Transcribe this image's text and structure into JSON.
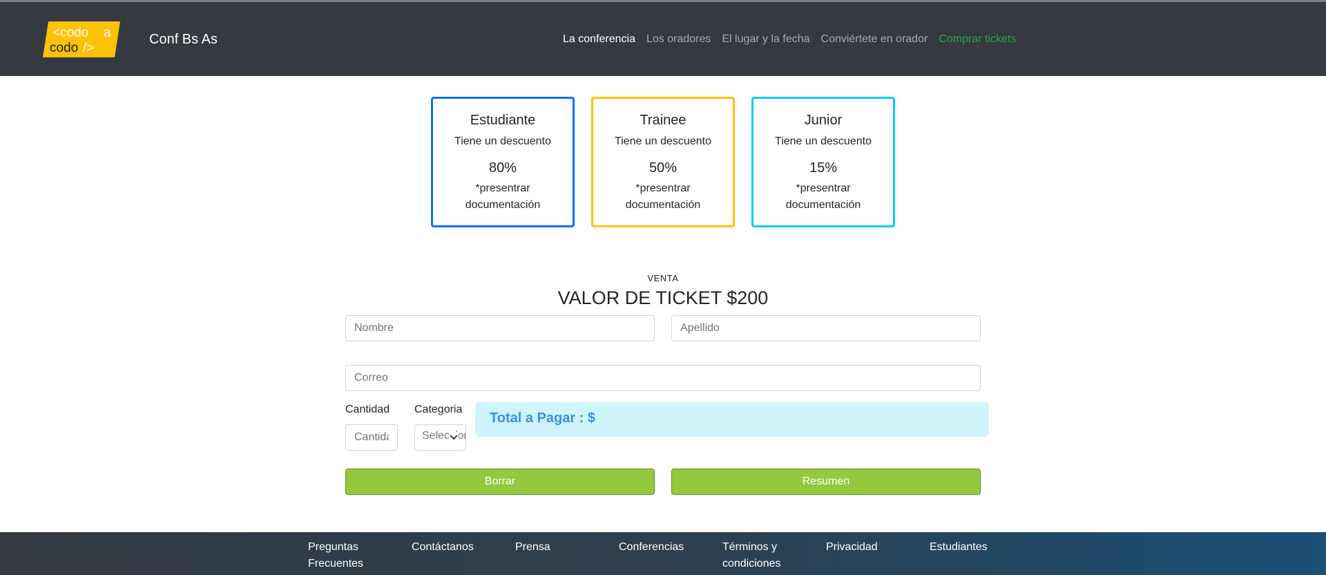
{
  "navbar": {
    "logo_text_line1": "<codo a",
    "logo_text_line2": "codo/>",
    "brand": "Conf Bs As",
    "links": [
      "La conferencia",
      "Los oradores",
      "El lugar y la fecha",
      "Conviértete en orador",
      "Comprar tickets"
    ]
  },
  "cards": [
    {
      "title": "Estudiante",
      "subtitle": "Tiene un descuento",
      "percent": "80%",
      "note": "*presentrar documentación",
      "color": "#0d6efd"
    },
    {
      "title": "Trainee",
      "subtitle": "Tiene un descuento",
      "percent": "50%",
      "note": "*presentrar documentación",
      "color": "#ffc107"
    },
    {
      "title": "Junior",
      "subtitle": "Tiene un descuento",
      "percent": "15%",
      "note": "*presentrar documentación",
      "color": "#0dcaf0"
    }
  ],
  "sale": {
    "kicker": "VENTA",
    "heading": "VALOR DE TICKET $200"
  },
  "form": {
    "nombre_placeholder": "Nombre",
    "apellido_placeholder": "Apellido",
    "correo_placeholder": "Correo",
    "cantidad_label": "Cantidad",
    "cantidad_placeholder": "Cantidad",
    "categoria_label": "Categoria",
    "categoria_selected": "Seleccionar",
    "total_text": "Total a Pagar : $",
    "borrar_label": "Borrar",
    "resumen_label": "Resumen"
  },
  "footer": {
    "links": [
      "Preguntas Frecuentes",
      "Contáctanos",
      "Prensa",
      "Conferencias",
      "Términos y condiciones",
      "Privacidad",
      "Estudiantes"
    ]
  },
  "colors": {
    "navbar_bg": "#343a40",
    "accent_green": "#95c93d",
    "buy_link": "#28a745",
    "total_bg": "#cff4fc",
    "logo_yellow": "#ffc107"
  }
}
